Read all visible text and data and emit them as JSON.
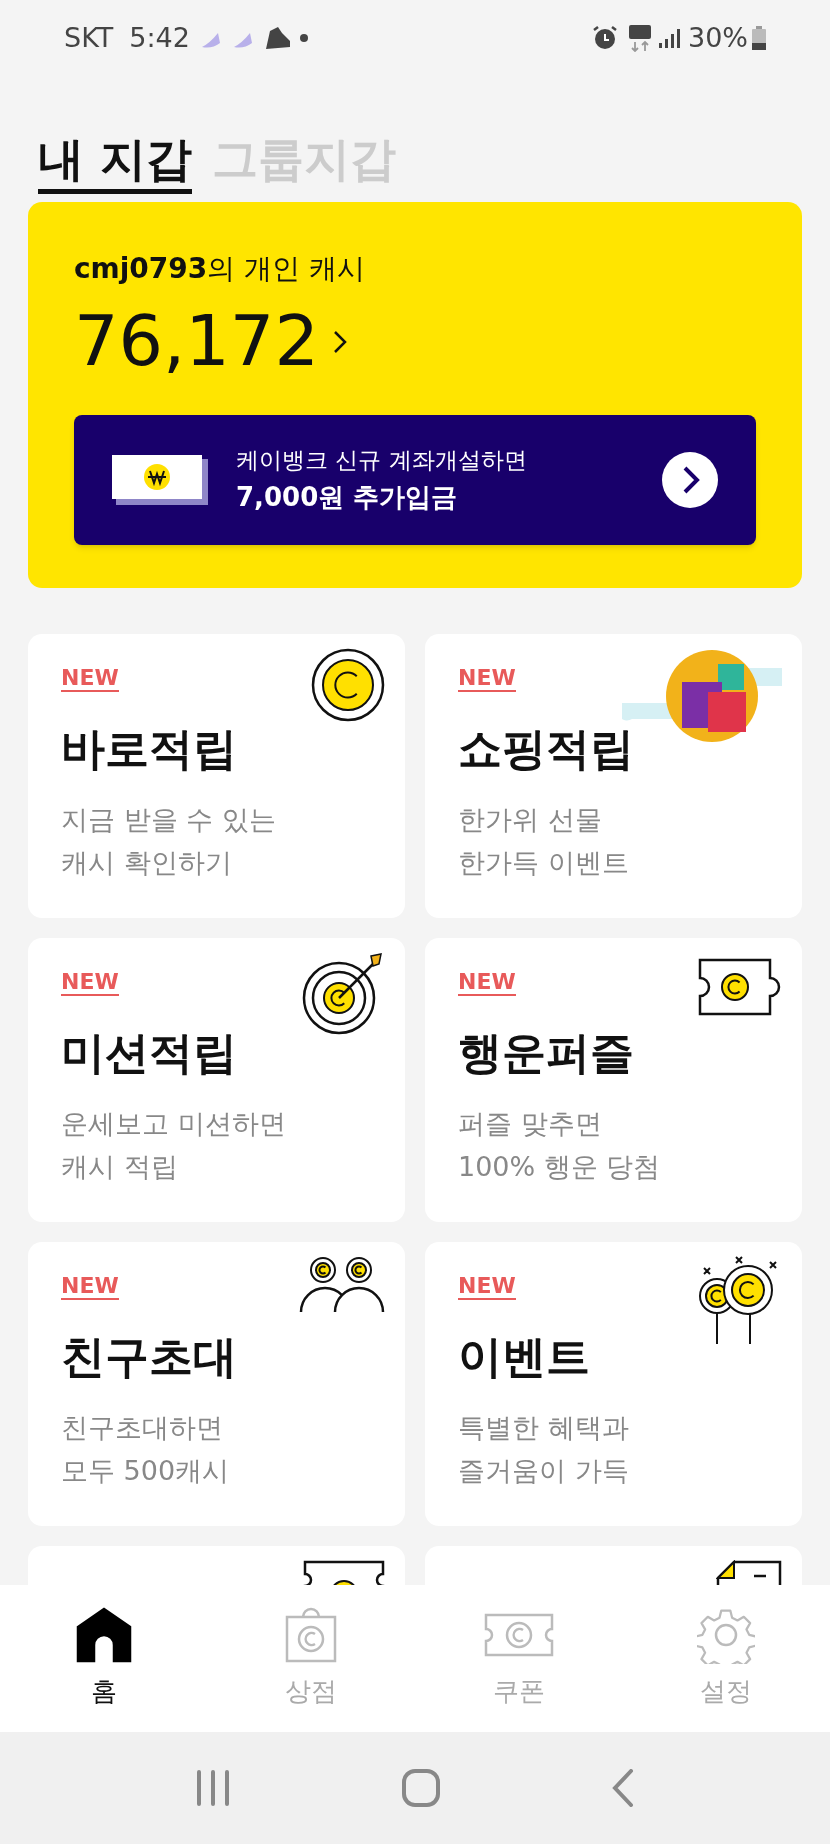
{
  "status_bar": {
    "carrier": "SKT",
    "time": "5:42",
    "battery": "30%"
  },
  "tabs": [
    {
      "label": "내 지갑",
      "selected": true
    },
    {
      "label": "그룹지갑",
      "selected": false
    }
  ],
  "wallet": {
    "owner": "**cmj0793**의 개인 캐시",
    "amount": "76,172"
  },
  "banner": {
    "line1": "케이뱅크 신규 계좌개설하면",
    "line2": "7,000원 추가입금"
  },
  "cards": [
    {
      "kind": "coin",
      "badge": "NEW",
      "title": "바로적립",
      "lines": [
        "지금 받을 수 있는",
        "캐시 확인하기"
      ]
    },
    {
      "kind": "gifts",
      "badge": "NEW",
      "title": "쇼핑적립",
      "lines": [
        "한가위 선물",
        "한가득 이벤트"
      ]
    },
    {
      "kind": "target",
      "badge": "NEW",
      "title": "미션적립",
      "lines": [
        "운세보고 미션하면",
        "캐시 적립"
      ]
    },
    {
      "kind": "puzzle",
      "badge": "NEW",
      "title": "행운퍼즐",
      "lines": [
        "퍼즐 맞추면",
        "100% 행운 당첨"
      ]
    },
    {
      "kind": "friends",
      "badge": "NEW",
      "title": "친구초대",
      "lines": [
        "친구초대하면",
        "모두 500캐시"
      ]
    },
    {
      "kind": "balloons",
      "badge": "NEW",
      "title": "이벤트",
      "lines": [
        "특별한 혜택과",
        "즐거움이 가득"
      ]
    },
    {
      "kind": "ticket"
    },
    {
      "kind": "note"
    }
  ],
  "nav": [
    {
      "kind": "home",
      "label": "홈",
      "selected": true
    },
    {
      "kind": "bag",
      "label": "상점",
      "selected": false
    },
    {
      "kind": "coupon",
      "label": "쿠폰",
      "selected": false
    },
    {
      "kind": "gear",
      "label": "설정",
      "selected": false
    }
  ]
}
